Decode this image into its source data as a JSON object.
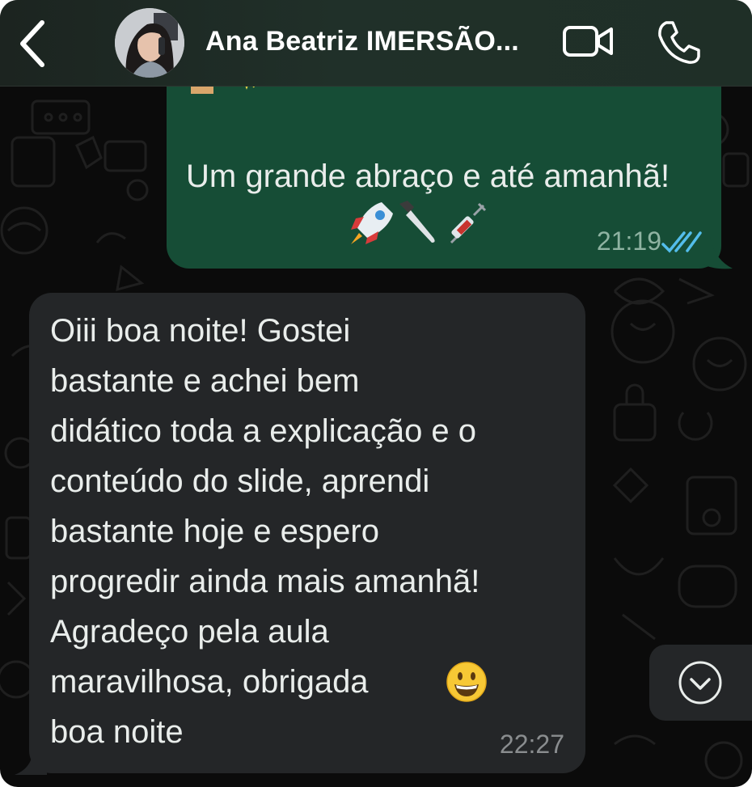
{
  "header": {
    "contact_name": "Ana Beatriz IMERSÃO..."
  },
  "outgoing_message": {
    "text": "Um grande abraço e até amanhã!",
    "emojis": [
      "rocket-icon",
      "knife-icon",
      "syringe-icon"
    ],
    "time": "21:19",
    "status": "read"
  },
  "incoming_message": {
    "text": "Oiii boa noite! Gostei\nbastante e achei bem\ndidático toda a explicação e o\nconteúdo do slide, aprendi\nbastante hoje e espero\nprogredir ainda mais amanhã!\nAgradeço pela aula\nmaravilhosa, obrigada\nboa noite",
    "emoji": "grinning-face-icon",
    "time": "22:27"
  },
  "colors": {
    "outgoing_bubble": "#164d36",
    "incoming_bubble": "#242628",
    "read_ticks": "#53bdeb",
    "background": "#0b0b0b"
  }
}
